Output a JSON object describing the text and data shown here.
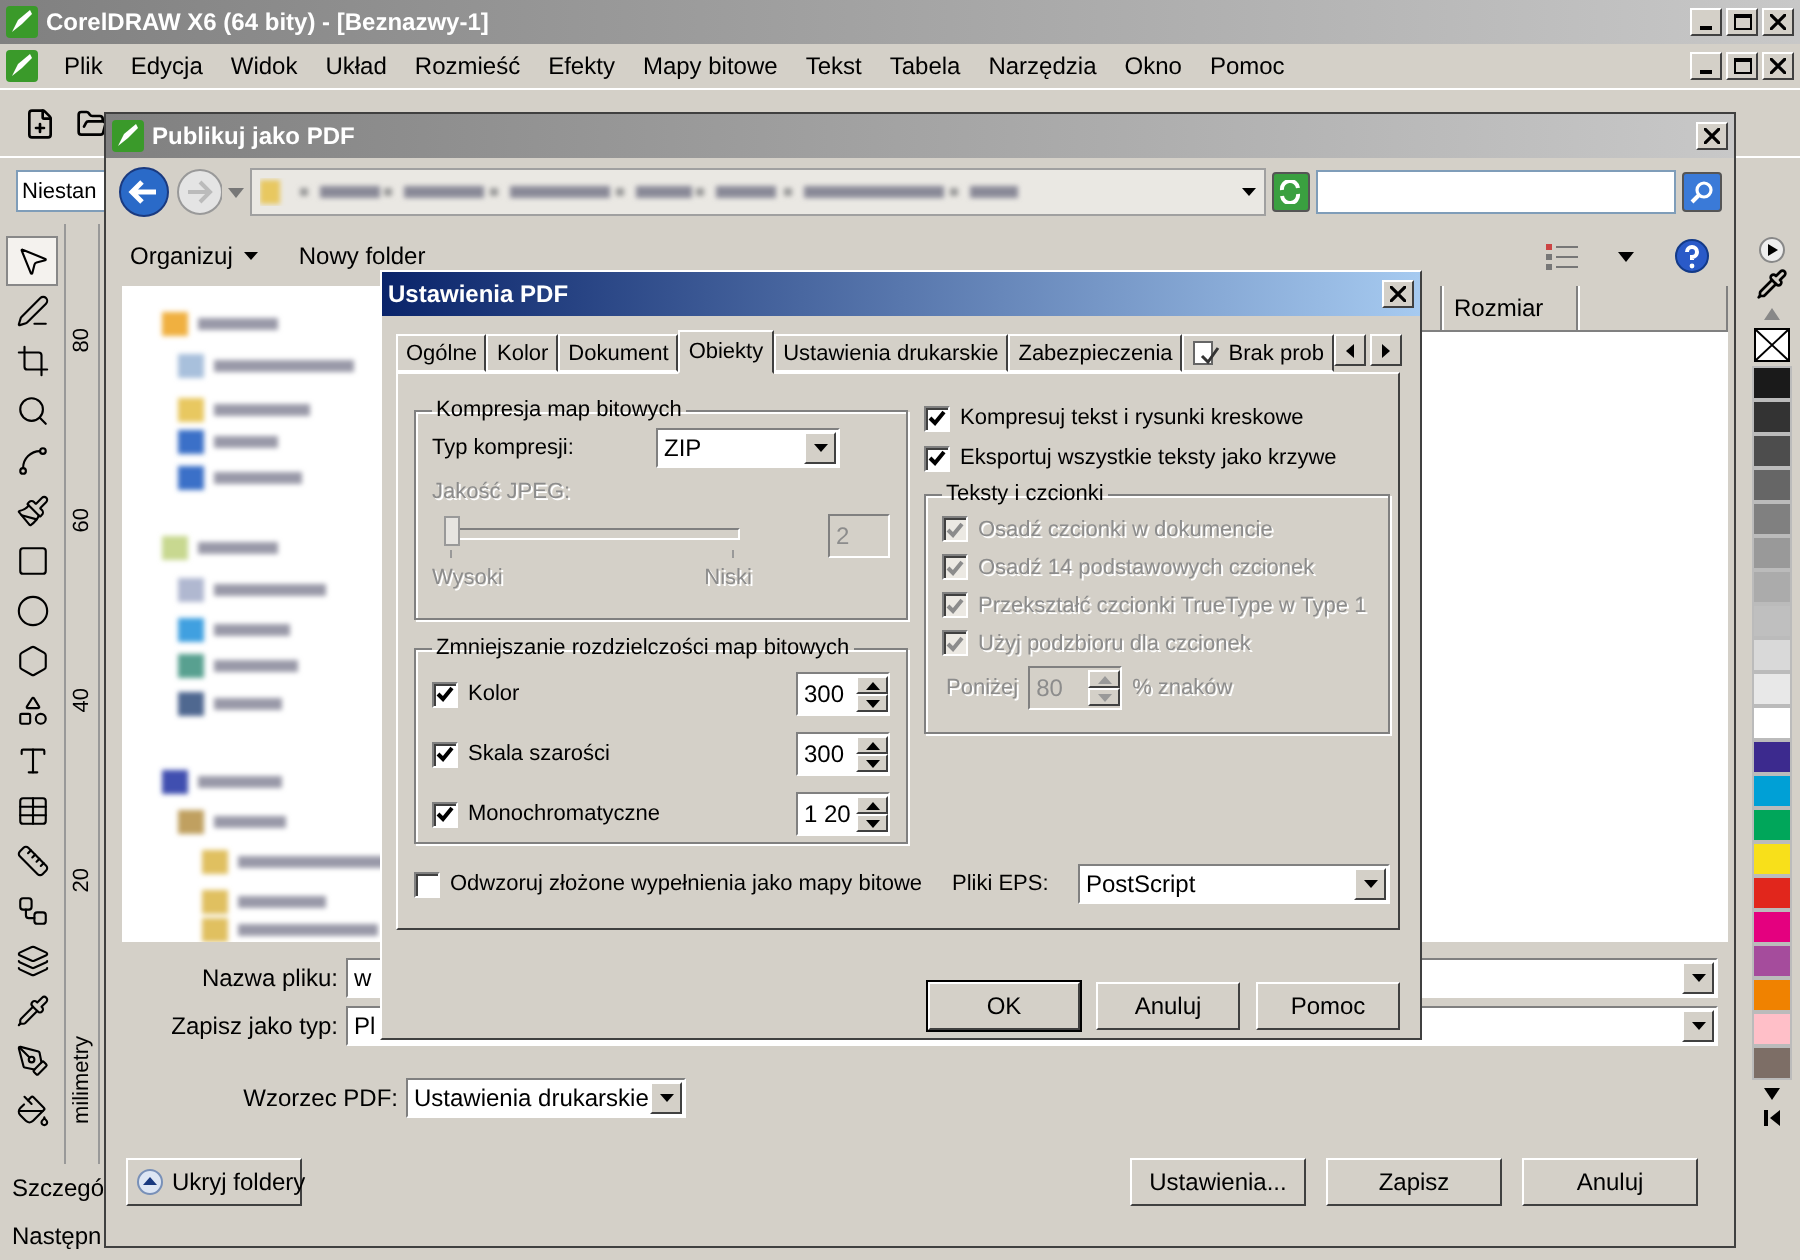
{
  "window": {
    "title": "CorelDRAW X6 (64 bity) - [Beznazwy-1]"
  },
  "menu": [
    "Plik",
    "Edycja",
    "Widok",
    "Układ",
    "Rozmieść",
    "Efekty",
    "Mapy bitowe",
    "Tekst",
    "Tabela",
    "Narzędzia",
    "Okno",
    "Pomoc"
  ],
  "property_bar": {
    "field_value": "Niestan"
  },
  "ruler": {
    "labels": [
      "80",
      "60",
      "40",
      "20"
    ],
    "unit": "milimetry"
  },
  "palette": [
    {
      "color": "#1a1a1a"
    },
    {
      "color": "#333333"
    },
    {
      "color": "#4d4d4d"
    },
    {
      "color": "#666666"
    },
    {
      "color": "#808080"
    },
    {
      "color": "#999999"
    },
    {
      "color": "#ababab"
    },
    {
      "color": "#bfbfbf"
    },
    {
      "color": "#d9d9d9"
    },
    {
      "color": "#e8e8e8"
    },
    {
      "color": "#ffffff"
    },
    {
      "color": "#3c2a8e"
    },
    {
      "color": "#00a0d6"
    },
    {
      "color": "#00a65a"
    },
    {
      "color": "#f8e01a"
    },
    {
      "color": "#e1261c"
    },
    {
      "color": "#e4007f"
    },
    {
      "color": "#a54c9c"
    },
    {
      "color": "#f08200"
    },
    {
      "color": "#ffbfc8"
    },
    {
      "color": "#7d6e66"
    }
  ],
  "status_bar": [
    "Szczegó",
    "Następn"
  ],
  "publish_dialog": {
    "title": "Publikuj jako PDF",
    "organize": "Organizuj",
    "new_folder": "Nowy folder",
    "columns": [
      "Rozmiar"
    ],
    "file_name": {
      "label": "Nazwa pliku:",
      "value": "w"
    },
    "save_as_type": {
      "label": "Zapisz jako typ:",
      "value": "Pl"
    },
    "preset": {
      "label": "Wzorzec PDF:",
      "value": "Ustawienia drukarskie"
    },
    "hide_folders": "Ukryj foldery",
    "buttons": [
      "Ustawienia...",
      "Zapisz",
      "Anuluj"
    ]
  },
  "settings_dialog": {
    "title": "Ustawienia PDF",
    "tabs": [
      {
        "label": "Ogólne",
        "selected": false
      },
      {
        "label": "Kolor",
        "selected": false
      },
      {
        "label": "Dokument",
        "selected": false
      },
      {
        "label": "Obiekty",
        "selected": true
      },
      {
        "label": "Ustawienia drukarskie",
        "selected": false
      },
      {
        "label": "Zabezpieczenia",
        "selected": false
      },
      {
        "label": "Brak prob",
        "selected": false,
        "kind": "icon"
      }
    ],
    "compression": {
      "title": "Kompresja map bitowych",
      "type_label": "Typ kompresji:",
      "type_value": "ZIP",
      "jpeg_label": "Jakość JPEG:",
      "jpeg_disabled": true,
      "level": 0,
      "jpeg_value": "2",
      "min_label": "Wysoki",
      "max_label": "Niski"
    },
    "downsample": {
      "title": "Zmniejszanie rozdzielczości map bitowych",
      "rows": [
        {
          "label": "Kolor",
          "checked": true,
          "value": "300"
        },
        {
          "label": "Skala szarości",
          "checked": true,
          "value": "300"
        },
        {
          "label": "Monochromatyczne",
          "checked": true,
          "value": "1 20"
        }
      ]
    },
    "render_complex": {
      "label": "Odwzoruj złożone wypełnienia jako mapy bitowe",
      "checked": false
    },
    "options": [
      {
        "label": "Kompresuj tekst i rysunki kreskowe",
        "checked": true
      },
      {
        "label": "Eksportuj wszystkie teksty jako krzywe",
        "checked": true
      }
    ],
    "fonts": {
      "title": "Teksty i czcionki",
      "items": [
        {
          "label": "Osadź czcionki w dokumencie",
          "checked": true,
          "disabled": true
        },
        {
          "label": "Osadź 14 podstawowych czcionek",
          "checked": true,
          "disabled": true
        },
        {
          "label": "Przekształć czcionki TrueType w Type 1",
          "checked": true,
          "disabled": true
        },
        {
          "label": "Użyj podzbioru dla czcionek",
          "checked": true,
          "disabled": true
        }
      ],
      "below_label": "Poniżej",
      "below_value": "80",
      "below_suffix": "% znaków",
      "below_disabled": true
    },
    "eps": {
      "label": "Pliki EPS:",
      "value": "PostScript"
    },
    "buttons": [
      {
        "label": "OK",
        "default": true
      },
      {
        "label": "Anuluj",
        "default": false
      },
      {
        "label": "Pomoc",
        "default": false
      }
    ]
  }
}
